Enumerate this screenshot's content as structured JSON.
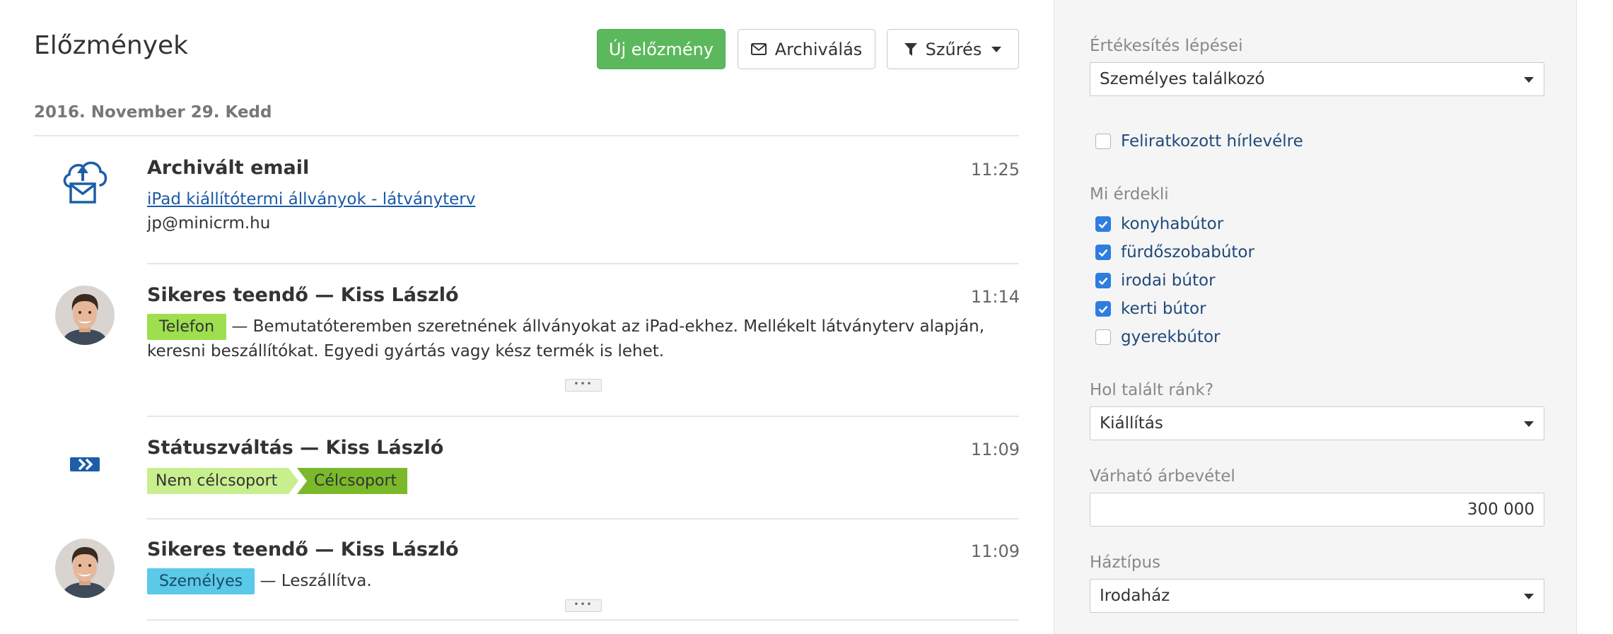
{
  "header": {
    "title": "Előzmények",
    "new_button": "Új előzmény",
    "archive_button": "Archiválás",
    "filter_button": "Szűrés"
  },
  "date": "2016. November 29. Kedd",
  "entries": [
    {
      "title": "Archivált email",
      "time": "11:25",
      "link": "iPad kiállítótermi állványok - látványterv",
      "email": "jp@minicrm.hu",
      "icon": "archived-email-icon"
    },
    {
      "title": "Sikeres teendő — Kiss László",
      "time": "11:14",
      "tag": "Telefon",
      "text_line1": "— Bemutatóteremben szeretnének állványokat az iPad-ekhez. Mellékelt látványterv alapján,",
      "text_line2": "keresni beszállítókat. Egyedi gyártás vagy kész termék is lehet.",
      "more": "•••"
    },
    {
      "title": "Státuszváltás — Kiss László",
      "time": "11:09",
      "from_status": "Nem célcsoport",
      "to_status": "Célcsoport",
      "icon": "status-change-icon"
    },
    {
      "title": "Sikeres teendő — Kiss László",
      "time": "11:09",
      "tag": "Személyes",
      "text": "— Leszállítva.",
      "more": "•••"
    }
  ],
  "sidebar": {
    "sales_steps_label": "Értékesítés lépései",
    "sales_steps_value": "Személyes találkozó",
    "newsletter_label": "Feliratkozott hírlevélre",
    "newsletter_checked": false,
    "interests_label": "Mi érdekli",
    "interests": [
      {
        "label": "konyhabútor",
        "checked": true
      },
      {
        "label": "fürdőszobabútor",
        "checked": true
      },
      {
        "label": "irodai bútor",
        "checked": true
      },
      {
        "label": "kerti bútor",
        "checked": true
      },
      {
        "label": "gyerekbútor",
        "checked": false
      }
    ],
    "source_label": "Hol talált ránk?",
    "source_value": "Kiállítás",
    "revenue_label": "Várható árbevétel",
    "revenue_value": "300 000",
    "house_type_label": "Háztípus",
    "house_type_value": "Irodaház"
  },
  "colors": {
    "primary_green": "#5cb85c",
    "tag_green": "#9ddf4e",
    "tag_blue": "#5bc9e8",
    "status_light": "#c8ef8e",
    "status_dark": "#7bb92a",
    "link_blue": "#1a5aa6",
    "icon_blue": "#1c5ea8",
    "checkbox_blue": "#2f7de1"
  }
}
